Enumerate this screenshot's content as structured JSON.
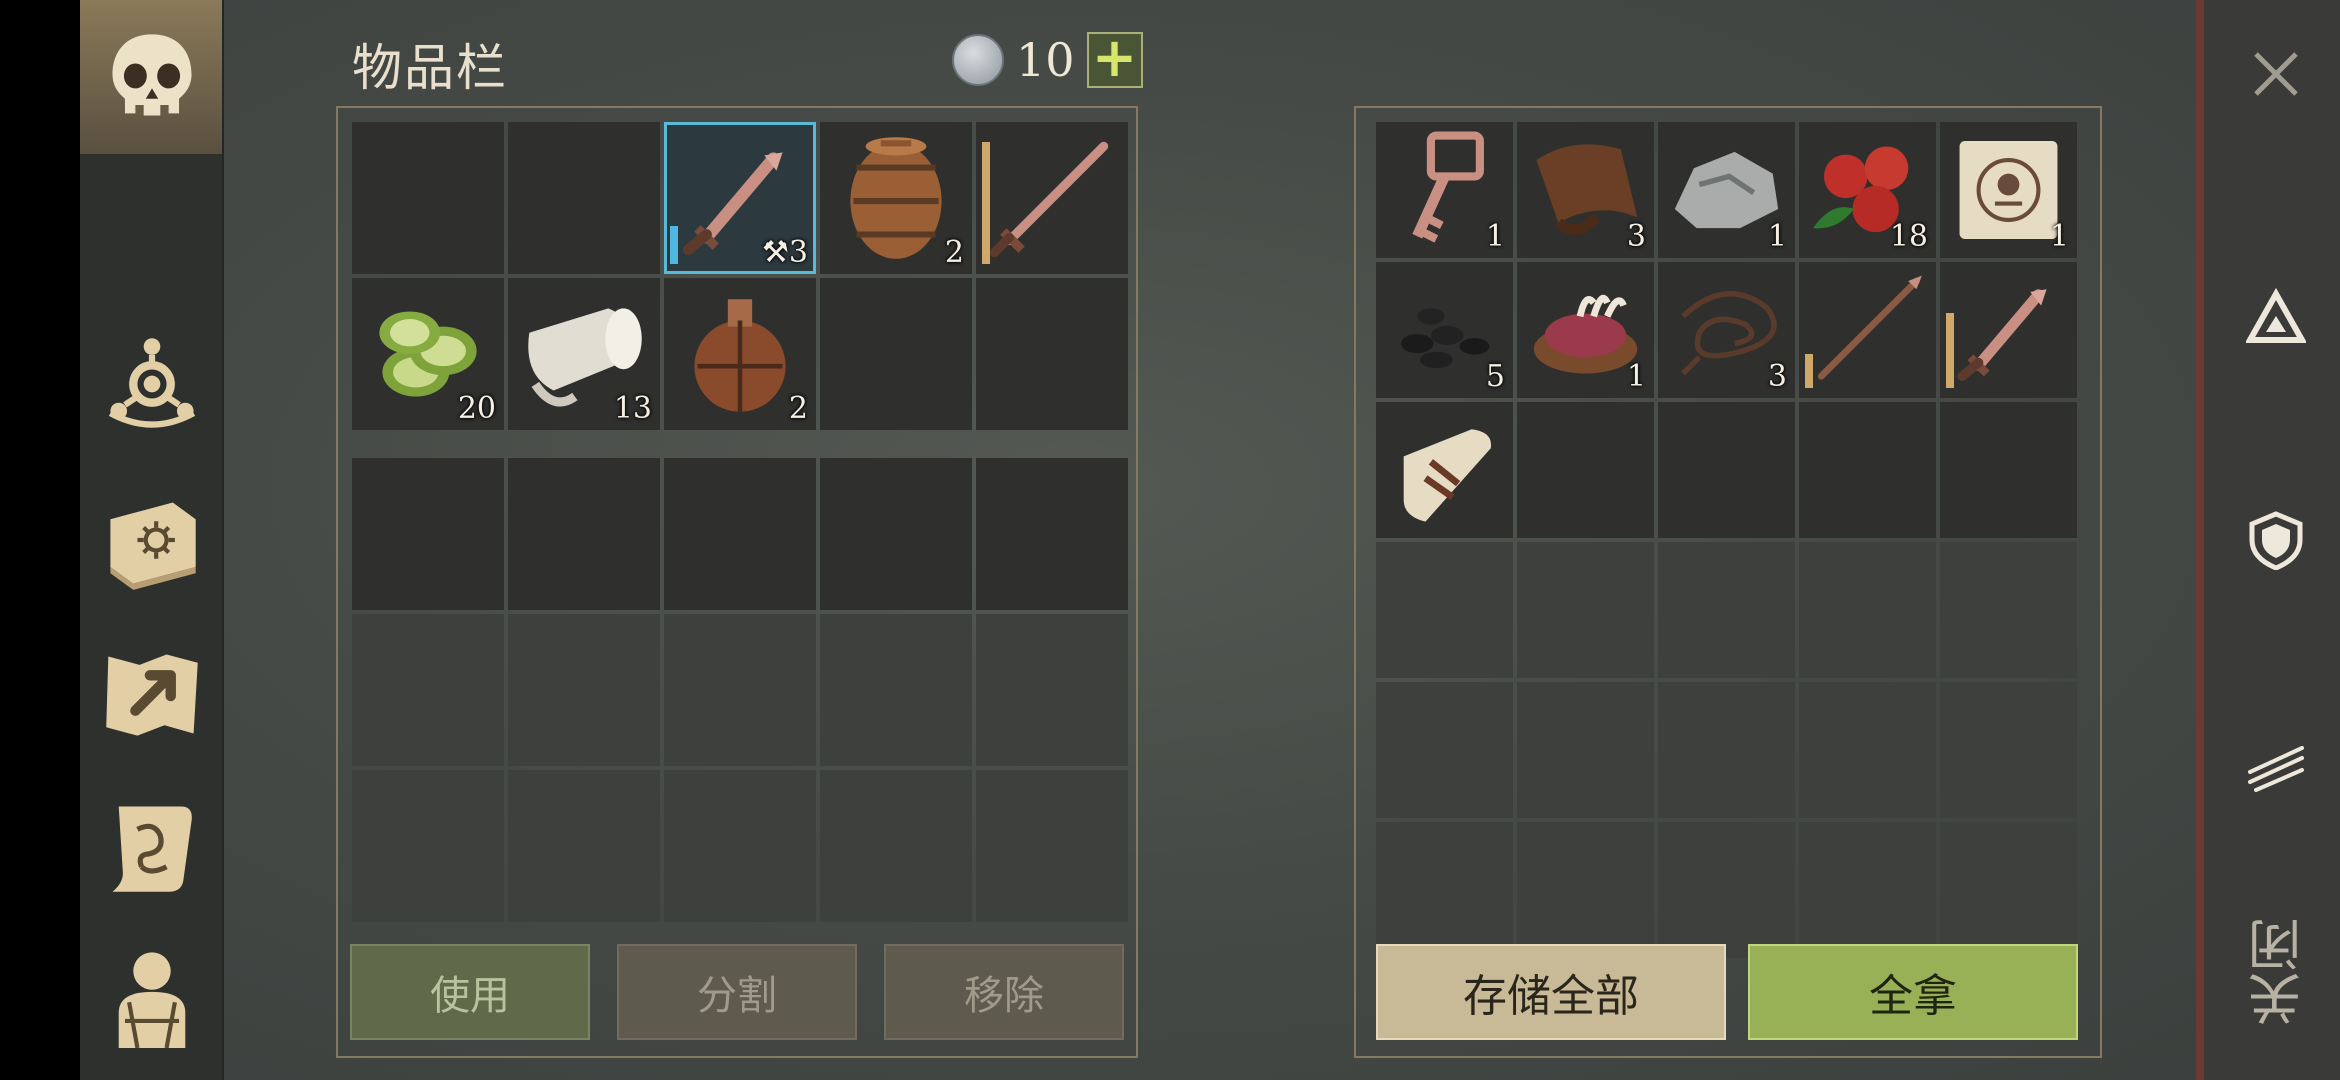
{
  "header": {
    "title": "物品栏",
    "currency_value": "10",
    "add_symbol": "+"
  },
  "left_nav": {
    "icons": [
      "skull-icon",
      "crafting-icon",
      "sun-book-icon",
      "map-icon",
      "quest-scroll-icon",
      "character-icon"
    ]
  },
  "right_nav": {
    "icons": [
      "close-icon",
      "camp-icon",
      "shield-icon",
      "claw-icon"
    ],
    "close_label": "关闭"
  },
  "inventory": {
    "slots": [
      {
        "item": "",
        "qty": ""
      },
      {
        "item": "",
        "qty": ""
      },
      {
        "item": "dagger",
        "qty": "3",
        "selected": true,
        "durability": 0.3,
        "dur_color": "blue",
        "prefix": "⚒"
      },
      {
        "item": "barrel",
        "qty": "2"
      },
      {
        "item": "sword",
        "qty": "",
        "durability": 0.95
      },
      {
        "item": "cucumber-slices",
        "qty": "20"
      },
      {
        "item": "cloth-roll",
        "qty": "13"
      },
      {
        "item": "flask",
        "qty": "2"
      },
      {
        "item": "",
        "qty": ""
      },
      {
        "item": "",
        "qty": ""
      }
    ],
    "extra_rows": 3
  },
  "container": {
    "slots": [
      {
        "item": "key",
        "qty": "1"
      },
      {
        "item": "leather",
        "qty": "3"
      },
      {
        "item": "stone",
        "qty": "1"
      },
      {
        "item": "berries",
        "qty": "18"
      },
      {
        "item": "map-scroll",
        "qty": "1"
      },
      {
        "item": "coal",
        "qty": "5"
      },
      {
        "item": "raw-meat",
        "qty": "1"
      },
      {
        "item": "rope",
        "qty": "3"
      },
      {
        "item": "spear",
        "qty": "",
        "durability": 0.3
      },
      {
        "item": "dagger",
        "qty": "",
        "durability": 0.65
      },
      {
        "item": "scroll",
        "qty": ""
      }
    ],
    "total_slots": 30
  },
  "buttons": {
    "use": "使用",
    "split": "分割",
    "remove": "移除",
    "store_all": "存储全部",
    "take_all": "全拿"
  },
  "colors": {
    "accent_green": "#98b056",
    "selection_blue": "#5bb9d8",
    "frame": "#857a5f"
  }
}
